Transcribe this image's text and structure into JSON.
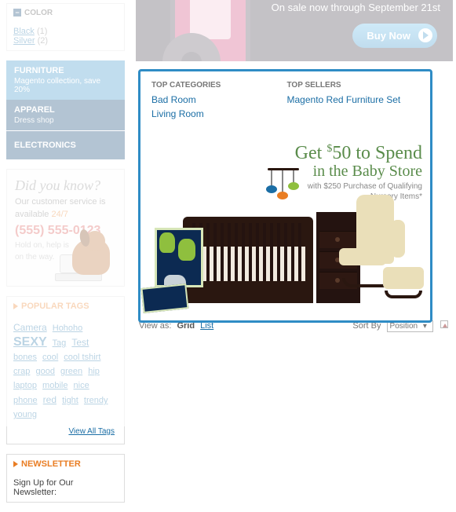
{
  "sidebar": {
    "color_block": {
      "header": "COLOR",
      "items": [
        {
          "label": "Black",
          "count": "(1)"
        },
        {
          "label": "Silver",
          "count": "(2)"
        }
      ]
    },
    "nav": {
      "furniture": {
        "title": "FURNITURE",
        "sub": "Magento collection, save 20%"
      },
      "apparel": {
        "title": "APPAREL",
        "sub": "Dress shop"
      },
      "electronics": {
        "title": "ELECTRONICS"
      }
    },
    "dyk": {
      "title": "Did you know?",
      "line1": "Our customer service is",
      "line2_a": "available ",
      "line2_b": "24/7",
      "phone": "(555) 555-0123",
      "hold1": "Hold on, help is",
      "hold2": "on the way."
    },
    "popular": {
      "header": "POPULAR TAGS",
      "tags": [
        "Camera",
        "Hohoho",
        "SEXY",
        "Tag",
        "Test",
        "bones",
        "cool",
        "cool tshirt",
        "crap",
        "good",
        "green",
        "hip",
        "laptop",
        "mobile",
        "nice",
        "phone",
        "red",
        "tight",
        "trendy",
        "young"
      ],
      "view_all": "View All Tags"
    },
    "newsletter": {
      "header": "NEWSLETTER",
      "line": "Sign Up for Our Newsletter:"
    }
  },
  "banner": {
    "sale_text": "On sale now through September 21st",
    "buy": "Buy Now"
  },
  "mega": {
    "left_header": "TOP CATEGORIES",
    "right_header": "TOP SELLERS",
    "categories": [
      "Bad Room",
      "Living Room"
    ],
    "sellers": [
      "Magento Red Furniture Set"
    ],
    "promo": {
      "h1_a": "Get ",
      "h1_b": "50 to Spend",
      "h2": "in the Baby Store",
      "fine1": "with $250 Purchase of Qualifying",
      "fine2": "Nursery Items*"
    }
  },
  "toolbar": {
    "view_as": "View as:",
    "grid": "Grid",
    "list": "List",
    "sort_by": "Sort By",
    "sort_val": "Position"
  }
}
